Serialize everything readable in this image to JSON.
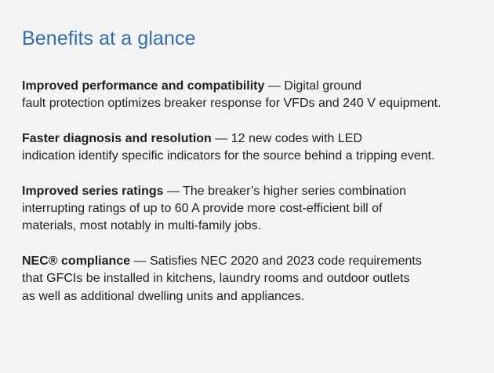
{
  "title": "Benefits at a glance",
  "separator": " — ",
  "benefits": [
    {
      "heading": "Improved performance and compatibility",
      "first_line": "Digital ground",
      "lines": [
        "fault protection optimizes breaker response for VFDs and 240 V equipment."
      ]
    },
    {
      "heading": "Faster diagnosis and resolution",
      "first_line": "12 new codes with LED",
      "lines": [
        "indication identify specific indicators for the source behind a tripping event."
      ]
    },
    {
      "heading": "Improved series ratings",
      "first_line": "The breaker’s higher series combination",
      "lines": [
        "interrupting ratings of up to 60 A provide more cost-efficient bill of",
        "materials, most notably in multi-family jobs."
      ]
    },
    {
      "heading": "NEC® compliance",
      "first_line": "Satisfies NEC 2020 and 2023 code requirements",
      "lines": [
        "that GFCIs be installed in kitchens, laundry rooms and outdoor outlets",
        "as well as additional dwelling units and appliances."
      ]
    }
  ]
}
